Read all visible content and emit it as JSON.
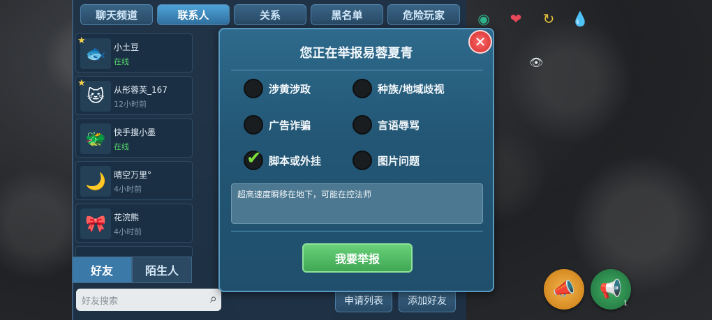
{
  "top_tabs": [
    {
      "label": "聊天频道",
      "active": false
    },
    {
      "label": "联系人",
      "active": true
    },
    {
      "label": "关系",
      "active": false
    },
    {
      "label": "黑名单",
      "active": false
    },
    {
      "label": "危险玩家",
      "active": false
    }
  ],
  "contacts": [
    {
      "name": "小土豆",
      "status": "在线",
      "online": true,
      "avatar": "🐟",
      "starred": true
    },
    {
      "name": "从彤蓉芙_167",
      "status": "12小时前",
      "online": false,
      "avatar": "🐱",
      "starred": true
    },
    {
      "name": "快手搜小墨",
      "status": "在线",
      "online": true,
      "avatar": "🐲",
      "starred": false
    },
    {
      "name": "晴空万里°",
      "status": "4小时前",
      "online": false,
      "avatar": "🌙",
      "starred": false
    },
    {
      "name": "花浣熊",
      "status": "4小时前",
      "online": false,
      "avatar": "🎀",
      "starred": false
    }
  ],
  "bottom_tabs": [
    {
      "label": "好友",
      "active": true
    },
    {
      "label": "陌生人",
      "active": false
    }
  ],
  "search": {
    "placeholder": "好友搜索"
  },
  "side_buttons": {
    "apply_list": "申请列表",
    "add_friend": "添加好友"
  },
  "dialog": {
    "title": "您正在举报易蓉夏青",
    "options": [
      {
        "label": "涉黄涉政",
        "checked": false
      },
      {
        "label": "种族/地域歧视",
        "checked": false
      },
      {
        "label": "广告诈骗",
        "checked": false
      },
      {
        "label": "言语辱骂",
        "checked": false
      },
      {
        "label": "脚本或外挂",
        "checked": true
      },
      {
        "label": "图片问题",
        "checked": false
      }
    ],
    "reason": "超高速度瞬移在地下，可能在控法师",
    "submit": "我要举报",
    "close": "✕"
  },
  "hud": {
    "voice_count": "1"
  },
  "colors": {
    "accent": "#4fa3d7",
    "submit": "#3fa653",
    "close": "#d12a2a",
    "online": "#56d36b"
  }
}
